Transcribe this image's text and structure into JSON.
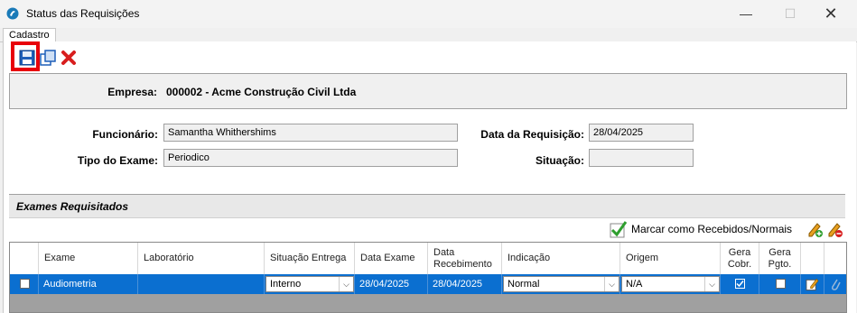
{
  "window": {
    "title": "Status das Requisições"
  },
  "tabs": {
    "cadastro": "Cadastro"
  },
  "empresa": {
    "label": "Empresa:",
    "value": "000002 - Acme Construção Civil Ltda"
  },
  "form": {
    "funcionario_label": "Funcionário:",
    "funcionario_value": "Samantha Whithershims",
    "tipo_label": "Tipo do Exame:",
    "tipo_value": "Periodico",
    "data_label": "Data da Requisição:",
    "data_value": "28/04/2025",
    "situacao_label": "Situação:",
    "situacao_value": ""
  },
  "exames": {
    "title": "Exames Requisitados",
    "marcar_label": "Marcar como Recebidos/Normais",
    "columns": {
      "exame": "Exame",
      "laboratorio": "Laboratório",
      "situacao_entrega": "Situação Entrega",
      "data_exame": "Data Exame",
      "data_recebimento": "Data Recebimento",
      "indicacao": "Indicação",
      "origem": "Origem",
      "gera_cobr": "Gera Cobr.",
      "gera_pgto": "Gera Pgto."
    },
    "row": {
      "exame": "Audiometria",
      "laboratorio": "",
      "situacao_entrega": "Interno",
      "data_exame": "28/04/2025",
      "data_recebimento": "28/04/2025",
      "indicacao": "Normal",
      "origem": "N/A",
      "gera_cobr": true,
      "gera_pgto": false
    }
  },
  "icons": {
    "save": "save-icon",
    "copy": "copy-icon",
    "delete": "delete-icon",
    "check": "green-check-icon",
    "edit_add": "pencil-add-icon",
    "edit_remove": "pencil-remove-icon",
    "row_edit": "edit-icon",
    "attach": "paperclip-icon"
  },
  "colors": {
    "selection": "#0b6fd0",
    "highlight": "#e8000a",
    "delete": "#d81e1e"
  }
}
